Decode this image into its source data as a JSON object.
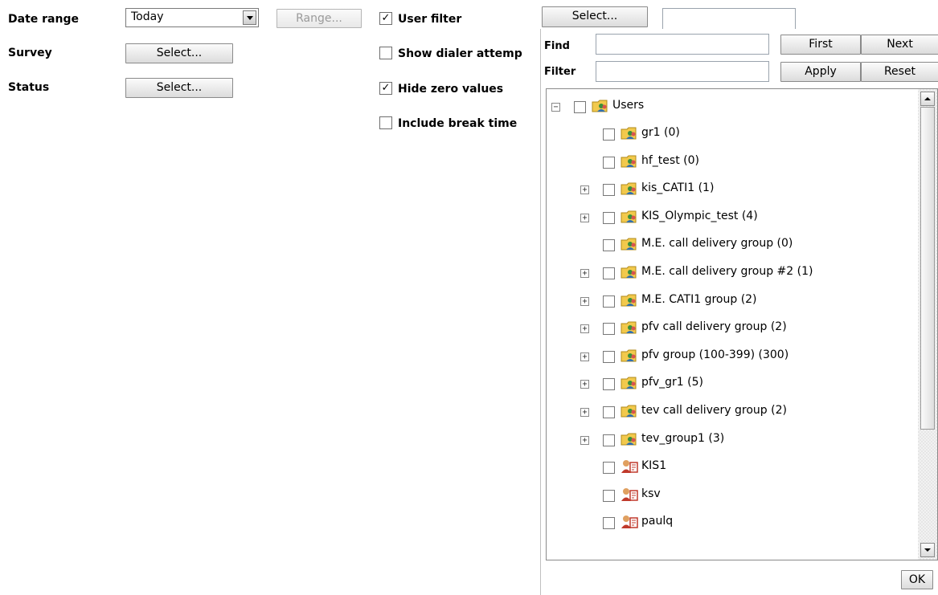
{
  "form": {
    "date_range_label": "Date range",
    "date_range_value": "Today",
    "range_button": "Range...",
    "survey_label": "Survey",
    "survey_button": "Select...",
    "status_label": "Status",
    "status_button": "Select...",
    "user_filter_label": "User filter",
    "user_filter_checked": true,
    "user_filter_button": "Select...",
    "user_filter_value": "",
    "show_dialer_label": "Show dialer attemp",
    "show_dialer_checked": false,
    "hide_zero_label": "Hide zero values",
    "hide_zero_checked": true,
    "include_break_label": "Include break time",
    "include_break_checked": false
  },
  "popup": {
    "find_label": "Find",
    "find_value": "",
    "first_button": "First",
    "next_button": "Next",
    "filter_label": "Filter",
    "filter_value": "",
    "apply_button": "Apply",
    "reset_button": "Reset",
    "ok_button": "OK",
    "tree_root": "Users",
    "tree_items": [
      {
        "label": "gr1 (0)",
        "expandable": false,
        "icon": "group-folder-icon"
      },
      {
        "label": "hf_test (0)",
        "expandable": false,
        "icon": "group-folder-icon"
      },
      {
        "label": "kis_CATI1 (1)",
        "expandable": true,
        "icon": "group-folder-icon"
      },
      {
        "label": "KIS_Olympic_test (4)",
        "expandable": true,
        "icon": "group-folder-icon"
      },
      {
        "label": "M.E. call delivery group (0)",
        "expandable": false,
        "icon": "group-folder-icon"
      },
      {
        "label": "M.E. call delivery group #2 (1)",
        "expandable": true,
        "icon": "group-folder-icon"
      },
      {
        "label": "M.E. CATI1 group (2)",
        "expandable": true,
        "icon": "group-folder-icon"
      },
      {
        "label": "pfv call delivery group (2)",
        "expandable": true,
        "icon": "group-folder-icon"
      },
      {
        "label": "pfv group (100-399) (300)",
        "expandable": true,
        "icon": "group-folder-icon"
      },
      {
        "label": "pfv_gr1 (5)",
        "expandable": true,
        "icon": "group-folder-icon"
      },
      {
        "label": "tev call delivery group (2)",
        "expandable": true,
        "icon": "group-folder-icon"
      },
      {
        "label": "tev_group1 (3)",
        "expandable": true,
        "icon": "group-folder-icon"
      },
      {
        "label": "KIS1",
        "expandable": false,
        "icon": "user-icon"
      },
      {
        "label": "ksv",
        "expandable": false,
        "icon": "user-icon"
      },
      {
        "label": "paulq",
        "expandable": false,
        "icon": "user-icon"
      }
    ]
  }
}
